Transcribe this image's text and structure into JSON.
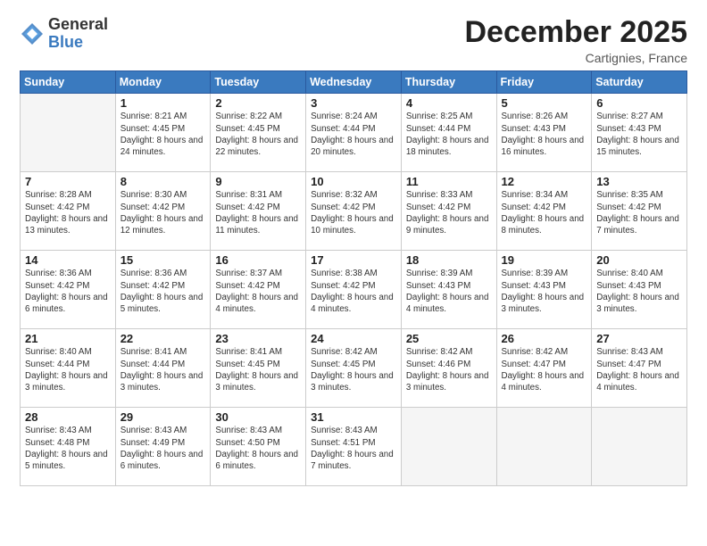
{
  "header": {
    "logo_general": "General",
    "logo_blue": "Blue",
    "month_title": "December 2025",
    "subtitle": "Cartignies, France"
  },
  "days_of_week": [
    "Sunday",
    "Monday",
    "Tuesday",
    "Wednesday",
    "Thursday",
    "Friday",
    "Saturday"
  ],
  "weeks": [
    [
      {
        "day": "",
        "empty": true
      },
      {
        "day": "1",
        "sunrise": "Sunrise: 8:21 AM",
        "sunset": "Sunset: 4:45 PM",
        "daylight": "Daylight: 8 hours and 24 minutes."
      },
      {
        "day": "2",
        "sunrise": "Sunrise: 8:22 AM",
        "sunset": "Sunset: 4:45 PM",
        "daylight": "Daylight: 8 hours and 22 minutes."
      },
      {
        "day": "3",
        "sunrise": "Sunrise: 8:24 AM",
        "sunset": "Sunset: 4:44 PM",
        "daylight": "Daylight: 8 hours and 20 minutes."
      },
      {
        "day": "4",
        "sunrise": "Sunrise: 8:25 AM",
        "sunset": "Sunset: 4:44 PM",
        "daylight": "Daylight: 8 hours and 18 minutes."
      },
      {
        "day": "5",
        "sunrise": "Sunrise: 8:26 AM",
        "sunset": "Sunset: 4:43 PM",
        "daylight": "Daylight: 8 hours and 16 minutes."
      },
      {
        "day": "6",
        "sunrise": "Sunrise: 8:27 AM",
        "sunset": "Sunset: 4:43 PM",
        "daylight": "Daylight: 8 hours and 15 minutes."
      }
    ],
    [
      {
        "day": "7",
        "sunrise": "Sunrise: 8:28 AM",
        "sunset": "Sunset: 4:42 PM",
        "daylight": "Daylight: 8 hours and 13 minutes."
      },
      {
        "day": "8",
        "sunrise": "Sunrise: 8:30 AM",
        "sunset": "Sunset: 4:42 PM",
        "daylight": "Daylight: 8 hours and 12 minutes."
      },
      {
        "day": "9",
        "sunrise": "Sunrise: 8:31 AM",
        "sunset": "Sunset: 4:42 PM",
        "daylight": "Daylight: 8 hours and 11 minutes."
      },
      {
        "day": "10",
        "sunrise": "Sunrise: 8:32 AM",
        "sunset": "Sunset: 4:42 PM",
        "daylight": "Daylight: 8 hours and 10 minutes."
      },
      {
        "day": "11",
        "sunrise": "Sunrise: 8:33 AM",
        "sunset": "Sunset: 4:42 PM",
        "daylight": "Daylight: 8 hours and 9 minutes."
      },
      {
        "day": "12",
        "sunrise": "Sunrise: 8:34 AM",
        "sunset": "Sunset: 4:42 PM",
        "daylight": "Daylight: 8 hours and 8 minutes."
      },
      {
        "day": "13",
        "sunrise": "Sunrise: 8:35 AM",
        "sunset": "Sunset: 4:42 PM",
        "daylight": "Daylight: 8 hours and 7 minutes."
      }
    ],
    [
      {
        "day": "14",
        "sunrise": "Sunrise: 8:36 AM",
        "sunset": "Sunset: 4:42 PM",
        "daylight": "Daylight: 8 hours and 6 minutes."
      },
      {
        "day": "15",
        "sunrise": "Sunrise: 8:36 AM",
        "sunset": "Sunset: 4:42 PM",
        "daylight": "Daylight: 8 hours and 5 minutes."
      },
      {
        "day": "16",
        "sunrise": "Sunrise: 8:37 AM",
        "sunset": "Sunset: 4:42 PM",
        "daylight": "Daylight: 8 hours and 4 minutes."
      },
      {
        "day": "17",
        "sunrise": "Sunrise: 8:38 AM",
        "sunset": "Sunset: 4:42 PM",
        "daylight": "Daylight: 8 hours and 4 minutes."
      },
      {
        "day": "18",
        "sunrise": "Sunrise: 8:39 AM",
        "sunset": "Sunset: 4:43 PM",
        "daylight": "Daylight: 8 hours and 4 minutes."
      },
      {
        "day": "19",
        "sunrise": "Sunrise: 8:39 AM",
        "sunset": "Sunset: 4:43 PM",
        "daylight": "Daylight: 8 hours and 3 minutes."
      },
      {
        "day": "20",
        "sunrise": "Sunrise: 8:40 AM",
        "sunset": "Sunset: 4:43 PM",
        "daylight": "Daylight: 8 hours and 3 minutes."
      }
    ],
    [
      {
        "day": "21",
        "sunrise": "Sunrise: 8:40 AM",
        "sunset": "Sunset: 4:44 PM",
        "daylight": "Daylight: 8 hours and 3 minutes."
      },
      {
        "day": "22",
        "sunrise": "Sunrise: 8:41 AM",
        "sunset": "Sunset: 4:44 PM",
        "daylight": "Daylight: 8 hours and 3 minutes."
      },
      {
        "day": "23",
        "sunrise": "Sunrise: 8:41 AM",
        "sunset": "Sunset: 4:45 PM",
        "daylight": "Daylight: 8 hours and 3 minutes."
      },
      {
        "day": "24",
        "sunrise": "Sunrise: 8:42 AM",
        "sunset": "Sunset: 4:45 PM",
        "daylight": "Daylight: 8 hours and 3 minutes."
      },
      {
        "day": "25",
        "sunrise": "Sunrise: 8:42 AM",
        "sunset": "Sunset: 4:46 PM",
        "daylight": "Daylight: 8 hours and 3 minutes."
      },
      {
        "day": "26",
        "sunrise": "Sunrise: 8:42 AM",
        "sunset": "Sunset: 4:47 PM",
        "daylight": "Daylight: 8 hours and 4 minutes."
      },
      {
        "day": "27",
        "sunrise": "Sunrise: 8:43 AM",
        "sunset": "Sunset: 4:47 PM",
        "daylight": "Daylight: 8 hours and 4 minutes."
      }
    ],
    [
      {
        "day": "28",
        "sunrise": "Sunrise: 8:43 AM",
        "sunset": "Sunset: 4:48 PM",
        "daylight": "Daylight: 8 hours and 5 minutes."
      },
      {
        "day": "29",
        "sunrise": "Sunrise: 8:43 AM",
        "sunset": "Sunset: 4:49 PM",
        "daylight": "Daylight: 8 hours and 6 minutes."
      },
      {
        "day": "30",
        "sunrise": "Sunrise: 8:43 AM",
        "sunset": "Sunset: 4:50 PM",
        "daylight": "Daylight: 8 hours and 6 minutes."
      },
      {
        "day": "31",
        "sunrise": "Sunrise: 8:43 AM",
        "sunset": "Sunset: 4:51 PM",
        "daylight": "Daylight: 8 hours and 7 minutes."
      },
      {
        "day": "",
        "empty": true
      },
      {
        "day": "",
        "empty": true
      },
      {
        "day": "",
        "empty": true
      }
    ]
  ]
}
